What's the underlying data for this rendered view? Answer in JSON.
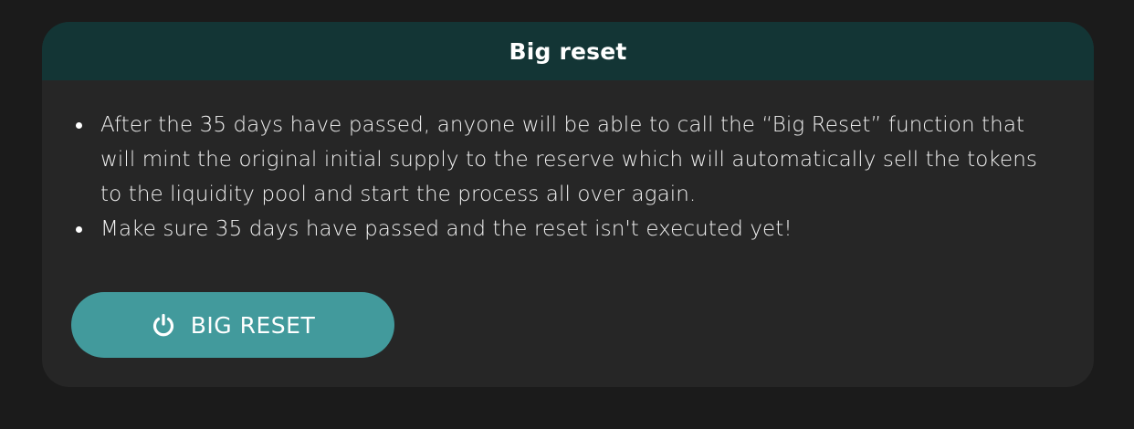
{
  "card": {
    "title": "Big reset",
    "bullets": [
      "After the 35 days have passed, anyone will be able to call the “Big Reset” function that will mint the original initial supply to the reserve which will automatically sell the tokens to the liquidity pool and start the process all over again.",
      "Make sure 35 days have passed and the reset isn't executed yet!"
    ]
  },
  "button": {
    "label": "BIG RESET",
    "icon": "power-icon"
  },
  "colors": {
    "background": "#1b1b1b",
    "card": "#262626",
    "header": "#133535",
    "button": "#429a9c"
  }
}
